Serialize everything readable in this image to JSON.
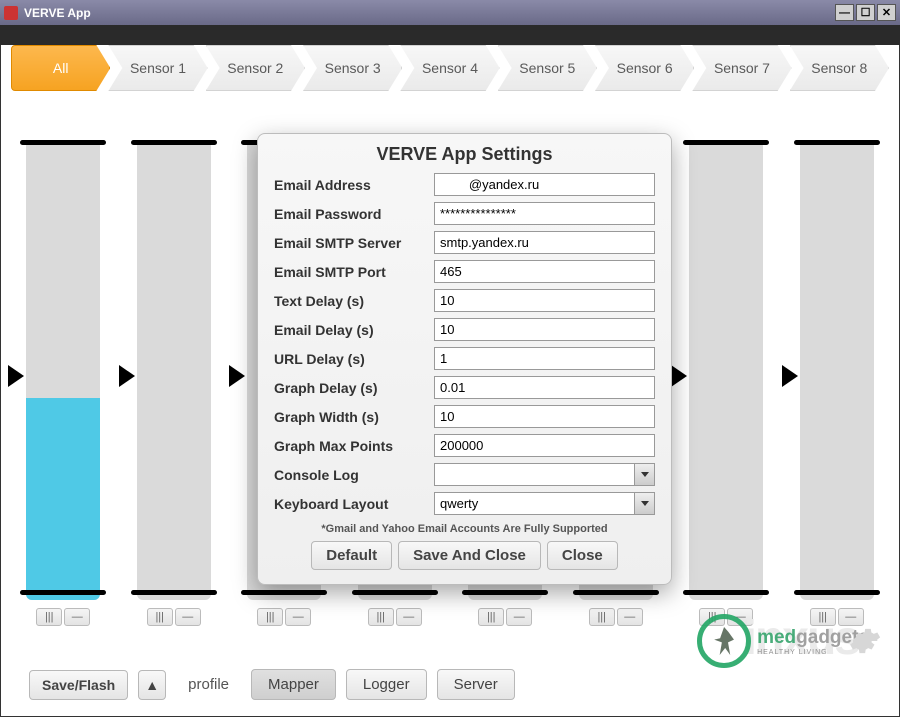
{
  "window": {
    "title": "VERVE App",
    "minimize_glyph": "—",
    "maximize_glyph": "☐",
    "close_glyph": "✕"
  },
  "tabs": {
    "items": [
      "All",
      "Sensor 1",
      "Sensor 2",
      "Sensor 3",
      "Sensor 4",
      "Sensor 5",
      "Sensor 6",
      "Sensor 7",
      "Sensor 8"
    ],
    "active_index": 0
  },
  "sliders": [
    {
      "fill_pct": 44,
      "arrow_top_pct": 49,
      "toggle_glyph": "|||",
      "minus_glyph": "—"
    },
    {
      "fill_pct": 0,
      "arrow_top_pct": 49,
      "toggle_glyph": "|||",
      "minus_glyph": "—"
    },
    {
      "fill_pct": 0,
      "arrow_top_pct": 49,
      "toggle_glyph": "|||",
      "minus_glyph": "—"
    },
    {
      "fill_pct": 0,
      "arrow_top_pct": 49,
      "toggle_glyph": "|||",
      "minus_glyph": "—"
    },
    {
      "fill_pct": 0,
      "arrow_top_pct": 49,
      "toggle_glyph": "|||",
      "minus_glyph": "—"
    },
    {
      "fill_pct": 0,
      "arrow_top_pct": 49,
      "toggle_glyph": "|||",
      "minus_glyph": "—"
    },
    {
      "fill_pct": 0,
      "arrow_top_pct": 49,
      "toggle_glyph": "|||",
      "minus_glyph": "—"
    },
    {
      "fill_pct": 0,
      "arrow_top_pct": 49,
      "toggle_glyph": "|||",
      "minus_glyph": "—"
    }
  ],
  "bottom": {
    "save_flash": "Save/Flash",
    "up_glyph": "▲",
    "profile": "profile",
    "mapper": "Mapper",
    "logger": "Logger",
    "server": "Server"
  },
  "dialog": {
    "title": "VERVE App Settings",
    "fields": {
      "email_address": {
        "label": "Email Address",
        "value": "        @yandex.ru"
      },
      "email_password": {
        "label": "Email Password",
        "value": "***************"
      },
      "smtp_server": {
        "label": "Email SMTP Server",
        "value": "smtp.yandex.ru"
      },
      "smtp_port": {
        "label": "Email SMTP Port",
        "value": "465"
      },
      "text_delay": {
        "label": "Text Delay (s)",
        "value": "10"
      },
      "email_delay": {
        "label": "Email Delay (s)",
        "value": "10"
      },
      "url_delay": {
        "label": "URL Delay (s)",
        "value": "1"
      },
      "graph_delay": {
        "label": "Graph Delay (s)",
        "value": "0.01"
      },
      "graph_width": {
        "label": "Graph Width (s)",
        "value": "10"
      },
      "graph_max_points": {
        "label": "Graph Max Points",
        "value": "200000"
      },
      "console_log": {
        "label": "Console Log",
        "value": ""
      },
      "keyboard_layout": {
        "label": "Keyboard Layout",
        "value": "qwerty"
      }
    },
    "footnote": "*Gmail and Yahoo Email Accounts Are Fully Supported",
    "buttons": {
      "default": "Default",
      "save_close": "Save And Close",
      "close": "Close"
    }
  },
  "branding": {
    "bgtext": "inxus",
    "m1": "med",
    "m2": "gadgets",
    "sub": "HEALTHY LIVING"
  }
}
